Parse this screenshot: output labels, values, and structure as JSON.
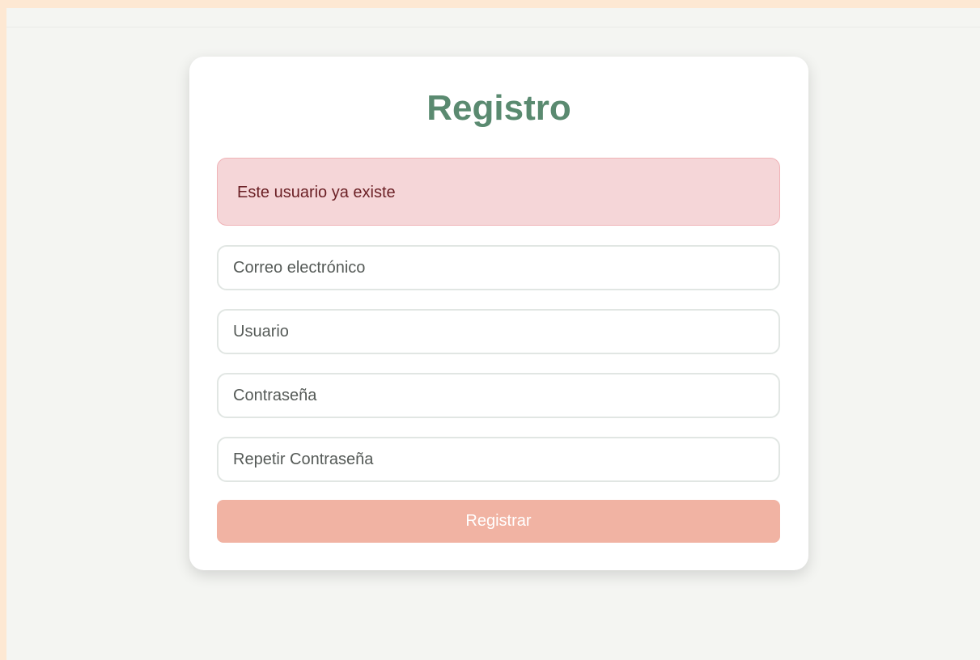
{
  "form": {
    "title": "Registro",
    "alert_message": "Este usuario ya existe",
    "fields": {
      "email": {
        "placeholder": "Correo electrónico",
        "value": ""
      },
      "username": {
        "placeholder": "Usuario",
        "value": ""
      },
      "password": {
        "placeholder": "Contraseña",
        "value": ""
      },
      "repeat_password": {
        "placeholder": "Repetir Contraseña",
        "value": ""
      }
    },
    "submit_label": "Registrar"
  },
  "colors": {
    "page_outer": "#fde8d3",
    "page_inner": "#f4f5f2",
    "title": "#5a8a70",
    "alert_bg": "#f5d6d8",
    "alert_text": "#6a1f24",
    "button_bg": "#f1b3a3"
  }
}
